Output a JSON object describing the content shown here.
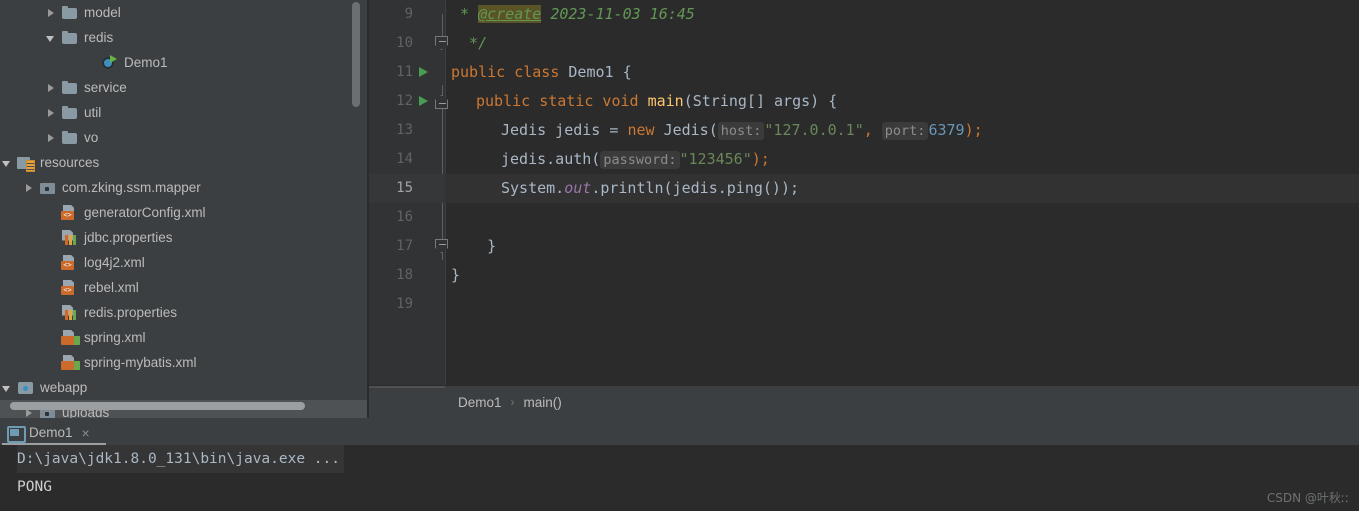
{
  "sidebar": {
    "name": "project-tree",
    "items": [
      {
        "label": "model",
        "icon": "folder-icon",
        "indent": 44,
        "arrow": "right",
        "selected": false
      },
      {
        "label": "redis",
        "icon": "folder-icon",
        "indent": 44,
        "arrow": "down",
        "selected": false
      },
      {
        "label": "Demo1",
        "icon": "java-class-run-icon",
        "indent": 84,
        "arrow": "none",
        "selected": false
      },
      {
        "label": "service",
        "icon": "folder-icon",
        "indent": 44,
        "arrow": "right",
        "selected": false
      },
      {
        "label": "util",
        "icon": "folder-icon",
        "indent": 44,
        "arrow": "right",
        "selected": false
      },
      {
        "label": "vo",
        "icon": "folder-icon",
        "indent": 44,
        "arrow": "right",
        "selected": false
      },
      {
        "label": "resources",
        "icon": "resources-folder-icon",
        "indent": 0,
        "arrow": "down",
        "selected": false
      },
      {
        "label": "com.zking.ssm.mapper",
        "icon": "package-folder-icon",
        "indent": 22,
        "arrow": "right",
        "selected": false
      },
      {
        "label": "generatorConfig.xml",
        "icon": "xml-file-icon",
        "indent": 44,
        "arrow": "none",
        "selected": false
      },
      {
        "label": "jdbc.properties",
        "icon": "properties-file-icon",
        "indent": 44,
        "arrow": "none",
        "selected": false
      },
      {
        "label": "log4j2.xml",
        "icon": "xml-file-icon",
        "indent": 44,
        "arrow": "none",
        "selected": false
      },
      {
        "label": "rebel.xml",
        "icon": "xml-file-icon",
        "indent": 44,
        "arrow": "none",
        "selected": false
      },
      {
        "label": "redis.properties",
        "icon": "properties-file-icon",
        "indent": 44,
        "arrow": "none",
        "selected": false
      },
      {
        "label": "spring.xml",
        "icon": "spring-xml-file-icon",
        "indent": 44,
        "arrow": "none",
        "selected": false
      },
      {
        "label": "spring-mybatis.xml",
        "icon": "spring-xml-file-icon",
        "indent": 44,
        "arrow": "none",
        "selected": false
      },
      {
        "label": "webapp",
        "icon": "webapp-folder-icon",
        "indent": 0,
        "arrow": "down",
        "selected": false
      },
      {
        "label": "uploads",
        "icon": "package-folder-icon",
        "indent": 22,
        "arrow": "right",
        "selected": true
      }
    ]
  },
  "editor": {
    "name": "code-editor",
    "file": "Demo1.java",
    "current_line": 15,
    "lines": [
      {
        "num": 9,
        "fold": "none",
        "run": false
      },
      {
        "num": 10,
        "fold": "open",
        "run": false
      },
      {
        "num": 11,
        "fold": "none",
        "run": true
      },
      {
        "num": 12,
        "fold": "close",
        "run": true
      },
      {
        "num": 13,
        "fold": "none",
        "run": false
      },
      {
        "num": 14,
        "fold": "none",
        "run": false
      },
      {
        "num": 15,
        "fold": "none",
        "run": false
      },
      {
        "num": 16,
        "fold": "none",
        "run": false
      },
      {
        "num": 17,
        "fold": "open",
        "run": false
      },
      {
        "num": 18,
        "fold": "none",
        "run": false
      },
      {
        "num": 19,
        "fold": "none",
        "run": false
      }
    ],
    "code_text": {
      "l9_star": " * ",
      "l9_tag": "@create",
      "l9_date": " 2023-11-03 16:45",
      "l10": "  */",
      "l11_kw": "public class ",
      "l11_name": "Demo1",
      "l11_brace": " {",
      "l12_kw": "public static void ",
      "l12_name": "main",
      "l12_args": "(String[] args) {",
      "l13_type": "Jedis jedis = ",
      "l13_new": "new ",
      "l13_ctor": "Jedis(",
      "l13_hint_host": "host:",
      "l13_host": "\"127.0.0.1\"",
      "l13_comma": ", ",
      "l13_hint_port": "port:",
      "l13_port": "6379",
      "l13_end": ");",
      "l14_call": "jedis.auth(",
      "l14_hint_password": "password:",
      "l14_pwd": "\"123456\"",
      "l14_end": ");",
      "l15_sys": "System.",
      "l15_out": "out",
      "l15_rest": ".println(jedis.ping());",
      "l17": "    }",
      "l18": "}"
    }
  },
  "breadcrumb": {
    "name": "editor-breadcrumb",
    "items": [
      "Demo1",
      "main()"
    ],
    "separator": "›"
  },
  "console": {
    "name": "run-console",
    "tab_label": "Demo1",
    "close_label": "×",
    "command_line": "D:\\java\\jdk1.8.0_131\\bin\\java.exe ...",
    "output_line": "PONG"
  },
  "watermark": {
    "text": "CSDN @叶秋ːː"
  },
  "colors": {
    "sidebar_bg": "#3c3f41",
    "editor_bg": "#2b2b2b",
    "gutter_bg": "#313335",
    "current_line_bg": "#323232",
    "keyword": "#cc7832",
    "string": "#6a8759",
    "number": "#6897bb",
    "comment": "#629755",
    "method": "#ffc66d",
    "field": "#9876aa",
    "default_text": "#a9b7c6",
    "run_green": "#499c54",
    "selection": "#4e5254"
  }
}
